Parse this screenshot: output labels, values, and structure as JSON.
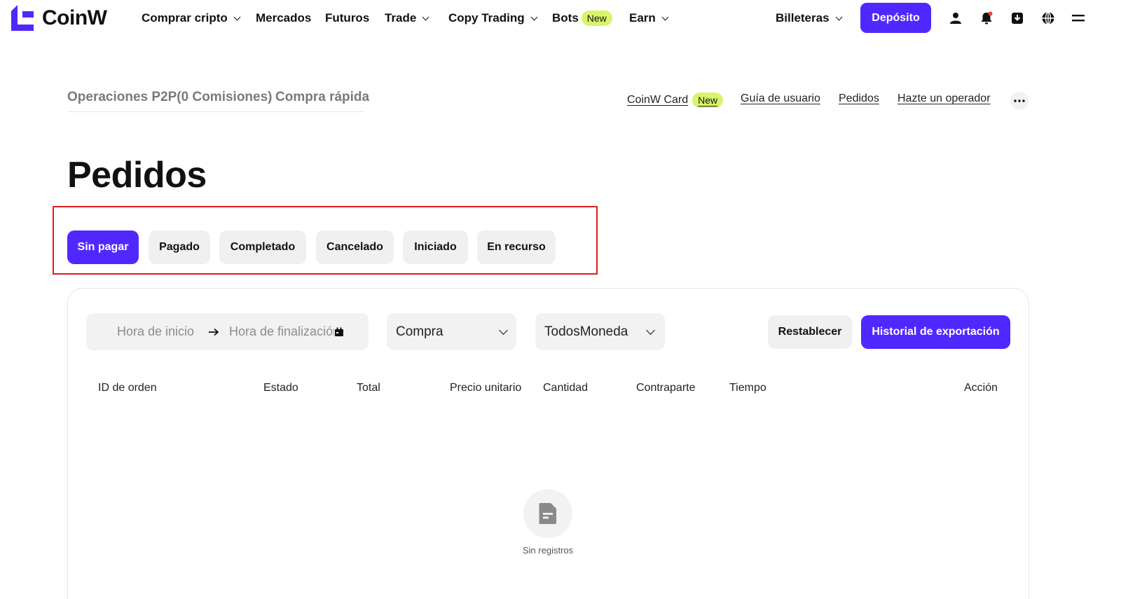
{
  "brand": {
    "name": "CoinW",
    "accent": "#5028ff",
    "badge_color": "#d8f56a"
  },
  "nav": {
    "items": [
      {
        "label": "Comprar cripto",
        "dropdown": true
      },
      {
        "label": "Mercados",
        "dropdown": false
      },
      {
        "label": "Futuros",
        "dropdown": false
      },
      {
        "label": "Trade",
        "dropdown": true
      },
      {
        "label": "Copy Trading",
        "dropdown": true
      },
      {
        "label": "Bots",
        "dropdown": false,
        "badge": "New"
      },
      {
        "label": "Earn",
        "dropdown": true
      }
    ],
    "wallets": "Billeteras",
    "deposit": "Depósito",
    "icons": [
      "user-icon",
      "bell-icon",
      "download-icon",
      "globe-icon",
      "menu-icon"
    ]
  },
  "subnav": {
    "tabs": [
      "Operaciones P2P(0 Comisiones)",
      "Compra rápida"
    ],
    "links": [
      {
        "label": "CoinW Card",
        "badge": "New"
      },
      {
        "label": "Guía de usuario"
      },
      {
        "label": "Pedidos"
      },
      {
        "label": "Hazte un operador"
      }
    ],
    "more_icon": "more-dots-icon"
  },
  "page": {
    "title": "Pedidos"
  },
  "status_tabs": [
    {
      "label": "Sin pagar",
      "active": true
    },
    {
      "label": "Pagado",
      "active": false
    },
    {
      "label": "Completado",
      "active": false
    },
    {
      "label": "Cancelado",
      "active": false
    },
    {
      "label": "Iniciado",
      "active": false
    },
    {
      "label": "En recurso",
      "active": false
    }
  ],
  "filters": {
    "start_placeholder": "Hora de inicio",
    "end_placeholder": "Hora de finalización",
    "type_value": "Compra",
    "coin_value": "TodosMoneda",
    "reset": "Restablecer",
    "export": "Historial de exportación"
  },
  "table": {
    "columns": [
      "ID de orden",
      "Estado",
      "Total",
      "Precio unitario",
      "Cantidad",
      "Contraparte",
      "Tiempo",
      "Acción"
    ],
    "rows": []
  },
  "empty": {
    "text": "Sin registros",
    "icon": "document-icon"
  }
}
